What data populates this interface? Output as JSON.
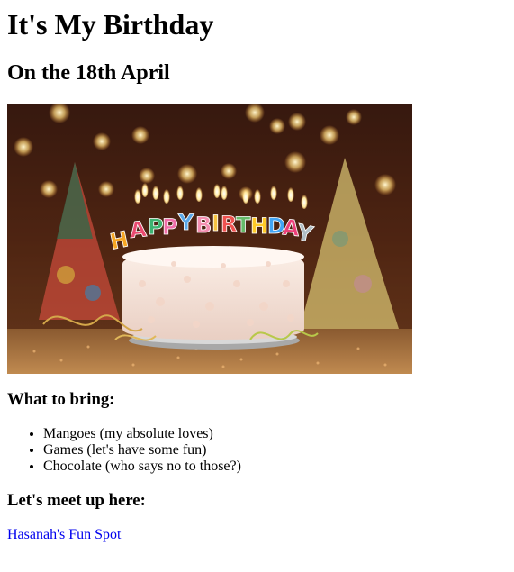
{
  "header": {
    "title": "It's My Birthday",
    "subtitle": "On the 18th April"
  },
  "image": {
    "name": "birthday-cake-photo",
    "candle_letters": [
      "H",
      "A",
      "P",
      "P",
      "Y",
      "B",
      "I",
      "R",
      "T",
      "H",
      "D",
      "A",
      "Y"
    ]
  },
  "bring": {
    "heading": "What to bring:",
    "items": [
      "Mangoes (my absolute loves)",
      "Games (let's have some fun)",
      "Chocolate (who says no to those?)"
    ]
  },
  "meet": {
    "heading": "Let's meet up here:",
    "link_text": "Hasanah's Fun Spot"
  },
  "colors": {
    "link": "#0000ee",
    "text": "#000000",
    "background": "#ffffff"
  }
}
